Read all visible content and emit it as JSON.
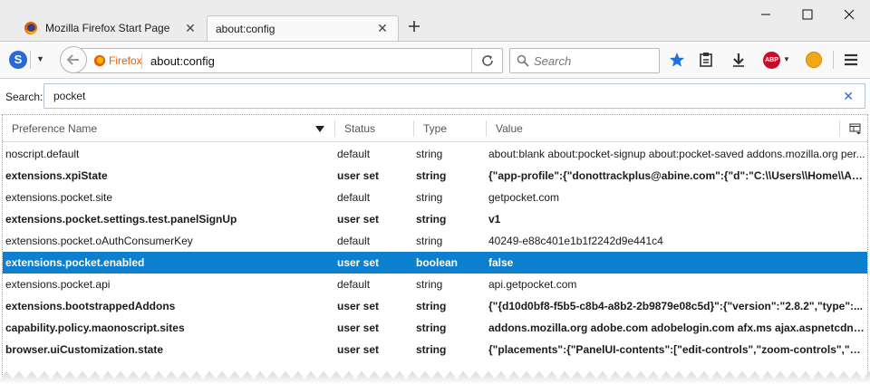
{
  "tabs": [
    {
      "label": "Mozilla Firefox Start Page",
      "active": false
    },
    {
      "label": "about:config",
      "active": true
    }
  ],
  "navbar": {
    "identity_label": "Firefox",
    "url": "about:config",
    "search_placeholder": "Search",
    "adblock_label": "ABP"
  },
  "config": {
    "search_label": "Search:",
    "search_value": "pocket",
    "columns": {
      "name": "Preference Name",
      "status": "Status",
      "type": "Type",
      "value": "Value"
    },
    "rows": [
      {
        "name": "noscript.default",
        "status": "default",
        "type": "string",
        "value": "about:blank about:pocket-signup about:pocket-saved addons.mozilla.org per...",
        "user_set": false,
        "selected": false
      },
      {
        "name": "extensions.xpiState",
        "status": "user set",
        "type": "string",
        "value": "{\"app-profile\":{\"donottrackplus@abine.com\":{\"d\":\"C:\\\\Users\\\\Home\\\\Ap...",
        "user_set": true,
        "selected": false
      },
      {
        "name": "extensions.pocket.site",
        "status": "default",
        "type": "string",
        "value": "getpocket.com",
        "user_set": false,
        "selected": false
      },
      {
        "name": "extensions.pocket.settings.test.panelSignUp",
        "status": "user set",
        "type": "string",
        "value": "v1",
        "user_set": true,
        "selected": false
      },
      {
        "name": "extensions.pocket.oAuthConsumerKey",
        "status": "default",
        "type": "string",
        "value": "40249-e88c401e1b1f2242d9e441c4",
        "user_set": false,
        "selected": false
      },
      {
        "name": "extensions.pocket.enabled",
        "status": "user set",
        "type": "boolean",
        "value": "false",
        "user_set": true,
        "selected": true
      },
      {
        "name": "extensions.pocket.api",
        "status": "default",
        "type": "string",
        "value": "api.getpocket.com",
        "user_set": false,
        "selected": false
      },
      {
        "name": "extensions.bootstrappedAddons",
        "status": "user set",
        "type": "string",
        "value": "{\"{d10d0bf8-f5b5-c8b4-a8b2-2b9879e08c5d}\":{\"version\":\"2.8.2\",\"type\":...",
        "user_set": true,
        "selected": false
      },
      {
        "name": "capability.policy.maonoscript.sites",
        "status": "user set",
        "type": "string",
        "value": "addons.mozilla.org adobe.com adobelogin.com afx.ms ajax.aspnetcdn.co...",
        "user_set": true,
        "selected": false
      },
      {
        "name": "browser.uiCustomization.state",
        "status": "user set",
        "type": "string",
        "value": "{\"placements\":{\"PanelUI-contents\":[\"edit-controls\",\"zoom-controls\",\"ne...",
        "user_set": true,
        "selected": false
      }
    ]
  },
  "colors": {
    "selection": "#0c7fce",
    "bookmark_star": "#1a73d9",
    "identity": "#e66000",
    "adblock": "#c70d2c"
  },
  "icons": {
    "firefox_favicon": "firefox-logo-icon",
    "close_tab": "close-icon",
    "new_tab": "plus-icon",
    "back": "back-arrow-icon",
    "reload": "reload-icon",
    "search": "search-icon",
    "bookmark": "star-icon",
    "library": "clipboard-icon",
    "downloads": "download-arrow-icon",
    "adblock": "adblock-plus-icon",
    "coin": "coin-icon",
    "menu": "hamburger-menu-icon",
    "clear": "close-icon",
    "column_picker": "column-picker-icon",
    "sort": "sort-desc-icon"
  }
}
